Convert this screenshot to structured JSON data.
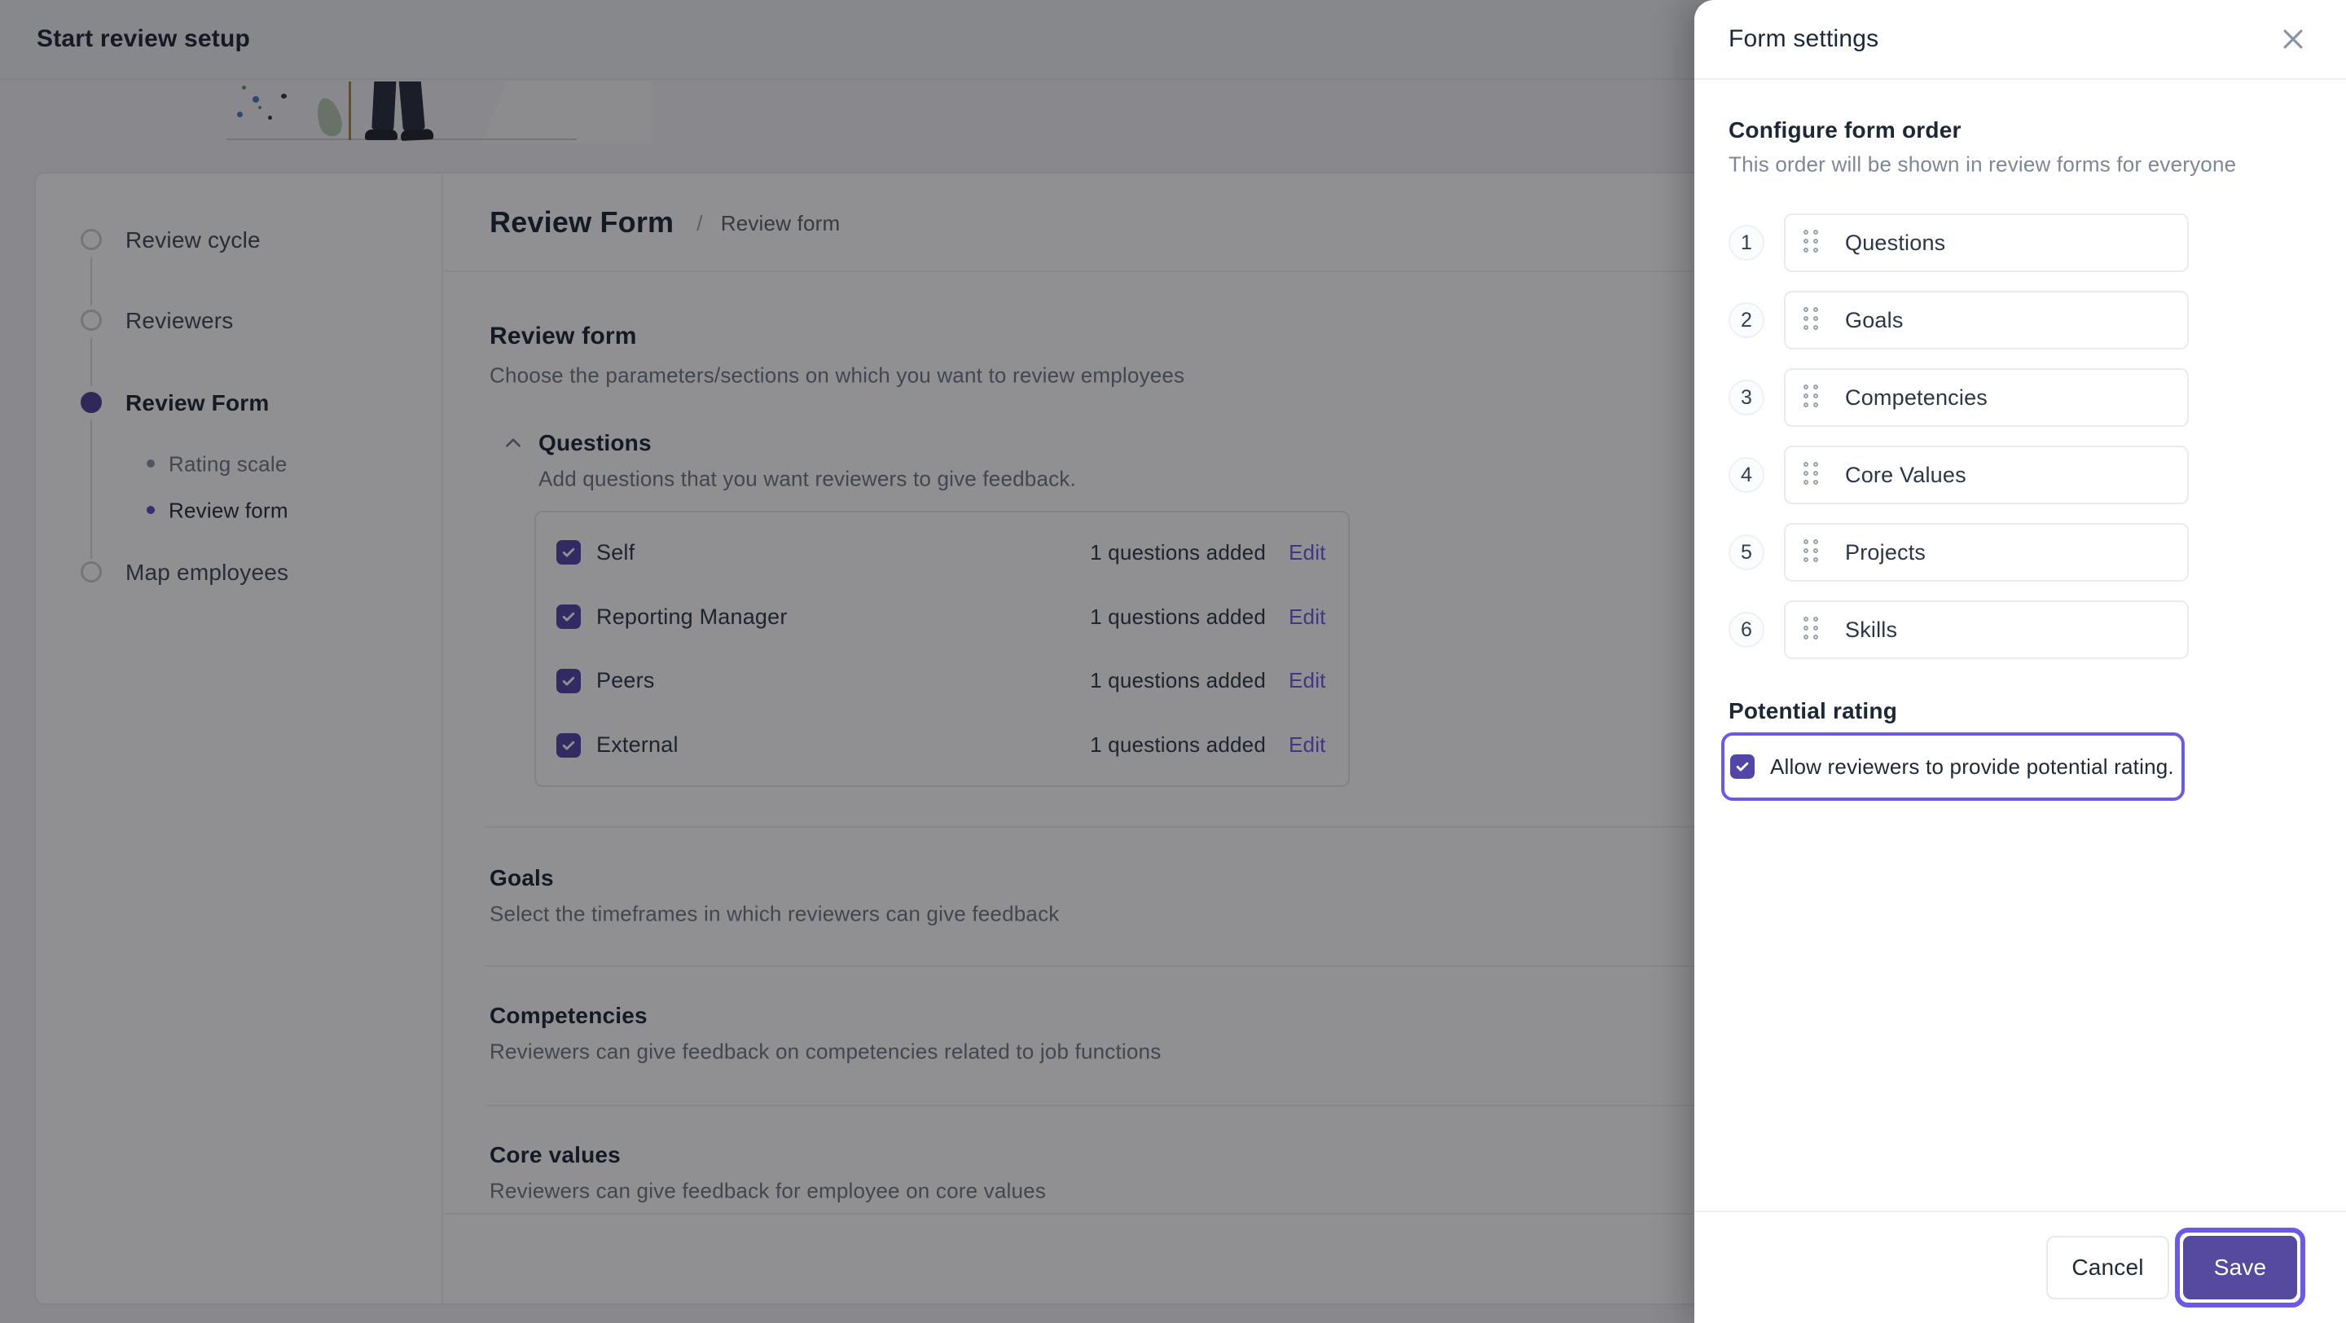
{
  "topbar": {
    "title": "Start review setup"
  },
  "stepper": {
    "items": [
      {
        "label": "Review cycle",
        "state": "pending"
      },
      {
        "label": "Reviewers",
        "state": "pending"
      },
      {
        "label": "Review Form",
        "state": "active",
        "children": [
          {
            "label": "Rating scale",
            "state": "pending"
          },
          {
            "label": "Review form",
            "state": "active"
          }
        ]
      },
      {
        "label": "Map employees",
        "state": "pending"
      }
    ]
  },
  "main": {
    "breadcrumb": {
      "primary": "Review Form",
      "separator": "/",
      "secondary": "Review form"
    },
    "section_title": "Review form",
    "section_description": "Choose the parameters/sections on which you want to review employees",
    "questions": {
      "title": "Questions",
      "description": "Add questions that you want reviewers to give feedback.",
      "rows": [
        {
          "label": "Self",
          "checked": true,
          "meta": "1 questions added",
          "action": "Edit"
        },
        {
          "label": "Reporting Manager",
          "checked": true,
          "meta": "1 questions added",
          "action": "Edit"
        },
        {
          "label": "Peers",
          "checked": true,
          "meta": "1 questions added",
          "action": "Edit"
        },
        {
          "label": "External",
          "checked": true,
          "meta": "1 questions added",
          "action": "Edit"
        }
      ]
    },
    "sections": [
      {
        "title": "Goals",
        "description": "Select the timeframes in which reviewers can give feedback"
      },
      {
        "title": "Competencies",
        "description": "Reviewers can give feedback on competencies related to job functions"
      },
      {
        "title": "Core values",
        "description": "Reviewers can give feedback for employee on core values"
      }
    ]
  },
  "panel": {
    "title": "Form settings",
    "order": {
      "title": "Configure form order",
      "subtitle": "This order will be shown in review forms for everyone",
      "items": [
        {
          "number": "1",
          "label": "Questions"
        },
        {
          "number": "2",
          "label": "Goals"
        },
        {
          "number": "3",
          "label": "Competencies"
        },
        {
          "number": "4",
          "label": "Core Values"
        },
        {
          "number": "5",
          "label": "Projects"
        },
        {
          "number": "6",
          "label": "Skills"
        }
      ]
    },
    "potential_rating": {
      "title": "Potential rating",
      "checkbox_label": "Allow reviewers to provide potential rating.",
      "checked": true
    },
    "footer": {
      "cancel_label": "Cancel",
      "save_label": "Save"
    }
  },
  "colors": {
    "accent": "#6a5ae8",
    "primary_button": "#564a9f",
    "checkbox_fill": "#5245a8",
    "scrim": "rgba(13,14,18,0.46)"
  }
}
